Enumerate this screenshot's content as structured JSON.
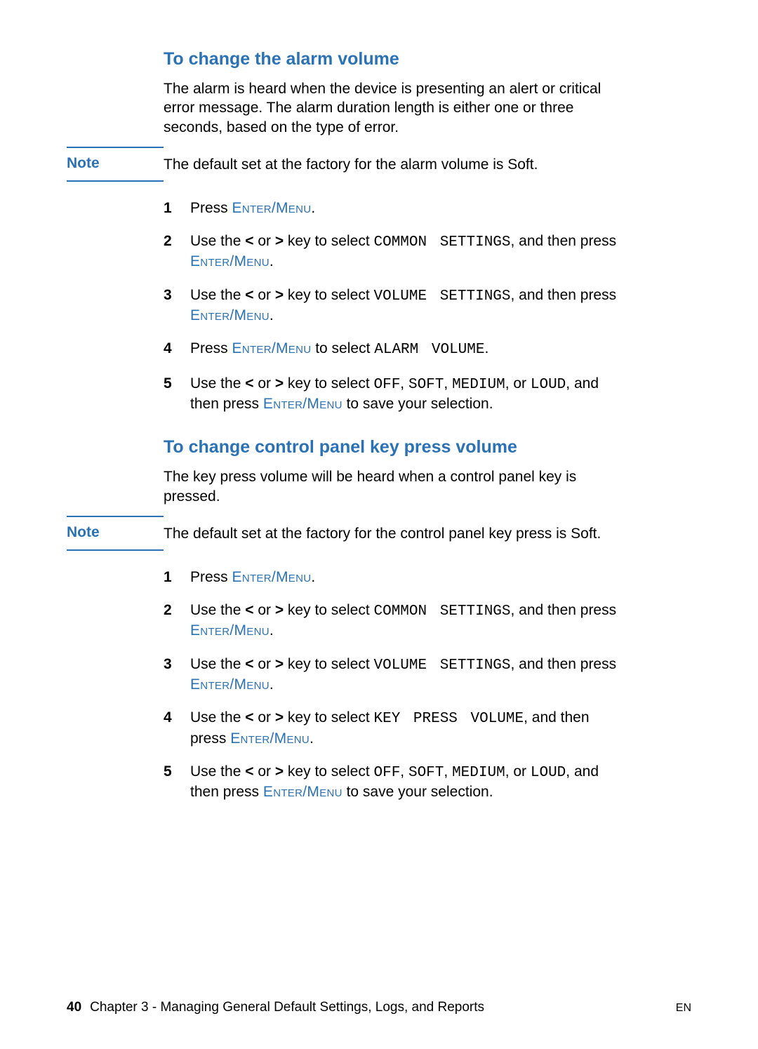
{
  "accent": "#2a72b5",
  "enter_menu": "Enter/Menu",
  "sec1": {
    "heading": "To change the alarm volume",
    "intro": "The alarm is heard when the device is presenting an alert or critical error message. The alarm duration length is either one or three seconds, based on the type of error.",
    "note_label": "Note",
    "note_text": "The default set at the factory for the alarm volume is Soft.",
    "steps": {
      "s1_a": "Press ",
      "s1_c": ".",
      "s2_a": "Use the ",
      "s2_b": " or ",
      "s2_c": " key to select ",
      "s2_code1": "COMMON SETTINGS",
      "s2_d": ", and then press ",
      "s2_f": ".",
      "s3_a": "Use the ",
      "s3_b": " or ",
      "s3_c": " key to select ",
      "s3_code1": "VOLUME SETTINGS",
      "s3_d": ", and then press ",
      "s3_f": ".",
      "s4_a": "Press ",
      "s4_c": " to select ",
      "s4_code1": "ALARM VOLUME",
      "s4_d": ".",
      "s5_a": "Use the ",
      "s5_b": " or ",
      "s5_c": " key to select ",
      "s5_off": "OFF",
      "s5_sep1": ", ",
      "s5_soft": "SOFT",
      "s5_sep2": ", ",
      "s5_med": "MEDIUM",
      "s5_sep3": ", or ",
      "s5_loud": "LOUD",
      "s5_d": ", and then press ",
      "s5_f": " to save your selection."
    }
  },
  "sec2": {
    "heading": "To change control panel key press volume",
    "intro": "The key press volume will be heard when a control panel key is pressed.",
    "note_label": "Note",
    "note_text": "The default set at the factory for the control panel key press is Soft.",
    "steps": {
      "s1_a": "Press ",
      "s1_c": ".",
      "s2_a": "Use the ",
      "s2_b": " or ",
      "s2_c": " key to select ",
      "s2_code1": "COMMON SETTINGS",
      "s2_d": ", and then press ",
      "s2_f": ".",
      "s3_a": "Use the ",
      "s3_b": " or ",
      "s3_c": " key to select ",
      "s3_code1": "VOLUME SETTINGS",
      "s3_d": ", and then press ",
      "s3_f": ".",
      "s4_a": "Use the ",
      "s4_b": " or ",
      "s4_c": " key to select ",
      "s4_code1": "KEY PRESS VOLUME",
      "s4_d": ", and then press ",
      "s4_f": ".",
      "s5_a": "Use the ",
      "s5_b": " or ",
      "s5_c": " key to select ",
      "s5_off": "OFF",
      "s5_sep1": ", ",
      "s5_soft": "SOFT",
      "s5_sep2": ", ",
      "s5_med": "MEDIUM",
      "s5_sep3": ", or ",
      "s5_loud": "LOUD",
      "s5_d": ", and then press ",
      "s5_f": " to save your selection."
    }
  },
  "lt": "<",
  "gt": ">",
  "footer": {
    "page": "40",
    "chapter": "Chapter 3 - Managing General Default Settings, Logs, and Reports",
    "en": "EN"
  }
}
